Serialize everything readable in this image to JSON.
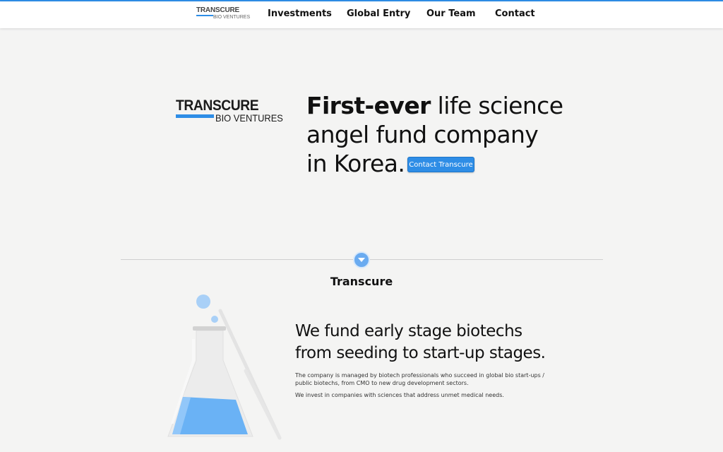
{
  "nav": {
    "logo_line1": "TRANSCURE",
    "logo_line2": "BIO VENTURES",
    "links": [
      "Investments",
      "Global Entry",
      "Our Team",
      "Contact"
    ]
  },
  "hero": {
    "logo_line1": "TRANSCURE",
    "logo_line2": "BIO VENTURES",
    "headline_bold": "First-ever",
    "headline_rest1": " life science",
    "headline_line2": "angel fund company",
    "headline_line3": "in Korea.",
    "contact_button": "Contact Transcure"
  },
  "section": {
    "scroll_icon": "chevron-down-icon",
    "title": "Transcure",
    "headline_line1": "We fund early stage biotechs",
    "headline_line2": "from seeding to start-up stages.",
    "paragraph1": "The company is managed by biotech professionals who succeed in global bio start-ups / public biotechs, from CMO to new drug development sectors.",
    "paragraph2": "We invest in companies with sciences that address unmet medical needs.",
    "illustration_icon": "flask-icon"
  },
  "colors": {
    "accent": "#2e8de6",
    "background": "#f4f4f3",
    "flask_liquid": "#6ab2f5"
  }
}
